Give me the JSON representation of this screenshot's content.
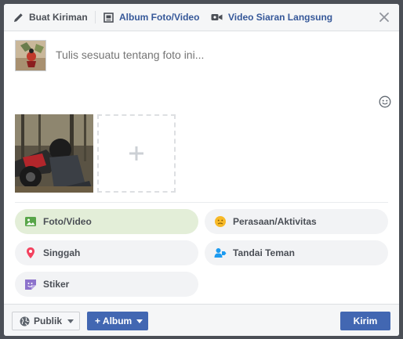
{
  "tabs": [
    {
      "label": "Buat Kiriman",
      "icon": "pencil-icon"
    },
    {
      "label": "Album Foto/Video",
      "icon": "photo-album-icon"
    },
    {
      "label": "Video Siaran Langsung",
      "icon": "video-camera-icon"
    }
  ],
  "composer": {
    "placeholder": "Tulis sesuatu tentang foto ini..."
  },
  "options": [
    {
      "label": "Foto/Video",
      "icon": "photo-icon",
      "selected": true
    },
    {
      "label": "Perasaan/Aktivitas",
      "icon": "smiley-icon"
    },
    {
      "label": "Singgah",
      "icon": "location-pin-icon"
    },
    {
      "label": "Tandai Teman",
      "icon": "tag-friend-icon"
    },
    {
      "label": "Stiker",
      "icon": "sticker-icon"
    }
  ],
  "footer": {
    "privacy_label": "Publik",
    "album_label": "+ Album",
    "submit_label": "Kirim"
  },
  "colors": {
    "brand": "#4267b2",
    "link": "#365899",
    "selected_option_bg": "#e3eed8"
  }
}
